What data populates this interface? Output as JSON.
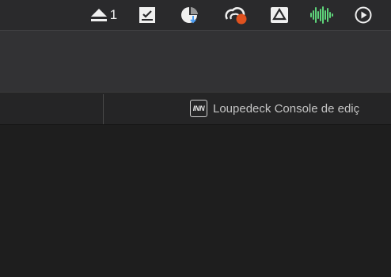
{
  "menubar": {
    "icons": [
      "eject-icon",
      "checklist-icon",
      "download-pie-icon",
      "creative-cloud-icon",
      "google-drive-icon",
      "audio-waveform-icon",
      "play-circle-icon"
    ],
    "eject_count": "1",
    "colors": {
      "notification": "#e0521f",
      "waveform": "#5ed47a",
      "icon": "#f0f0f0"
    }
  },
  "tabbar": {
    "active_tab": {
      "favicon_text": "INN",
      "title": "Loupedeck Console de ediç"
    }
  }
}
